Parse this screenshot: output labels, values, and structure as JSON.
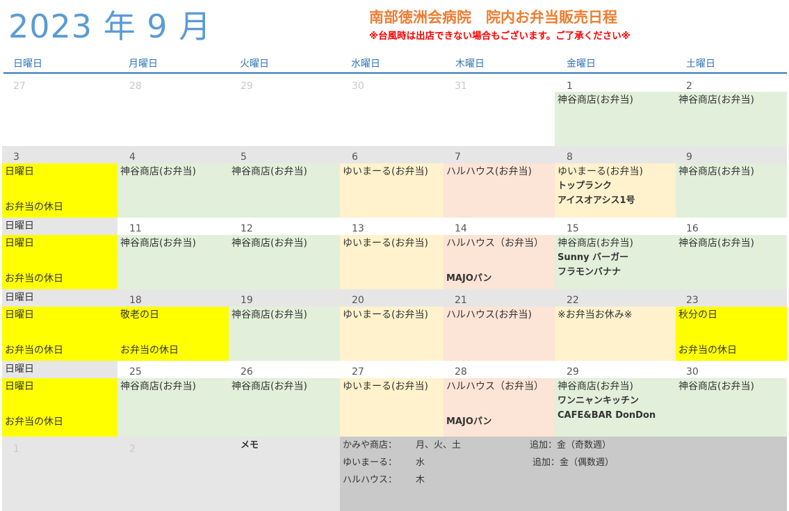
{
  "header": {
    "title": "2023 年 9 月",
    "hospital": "南部徳洲会病院　院内お弁当販売日程",
    "warning": "※台風時は出店できない場合もございます。ご了承ください※"
  },
  "weekdays": [
    "日曜日",
    "月曜日",
    "火曜日",
    "水曜日",
    "木曜日",
    "金曜日",
    "土曜日"
  ],
  "calendar": {
    "row1": {
      "dates": [
        "27",
        "28",
        "29",
        "30",
        "31",
        "1",
        "2"
      ],
      "fri": "神谷商店(お弁当)",
      "sat": "神谷商店(お弁当)"
    },
    "row2": {
      "dates": [
        "3",
        "4",
        "5",
        "6",
        "7",
        "8",
        "9"
      ],
      "sun_top": "日曜日",
      "sun_bottom": "お弁当の休日",
      "mon": "神谷商店(お弁当)",
      "tue": "神谷商店(お弁当)",
      "wed": "ゆいまーる(お弁当)",
      "thu": "ハルハウス(お弁当)",
      "fri": "ゆいまーる(お弁当)",
      "fri_extra1": "トップランク",
      "fri_extra2": "アイスオアシス1号",
      "sat": "神谷商店(お弁当)"
    },
    "row3": {
      "label": "日曜日",
      "dates": [
        "11",
        "12",
        "13",
        "14",
        "15",
        "16"
      ],
      "sun_top": "日曜日",
      "sun_bottom": "お弁当の休日",
      "mon": "神谷商店(お弁当)",
      "tue": "神谷商店(お弁当)",
      "wed": "ゆいまーる(お弁当)",
      "thu": "ハルハウス（お弁当）",
      "thu_extra": "MAJOパン",
      "fri": "神谷商店(お弁当)",
      "fri_extra1": "Sunny バーガー",
      "fri_extra2": "フラモンバナナ",
      "sat": "神谷商店(お弁当)"
    },
    "row4": {
      "label": "日曜日",
      "dates": [
        "18",
        "19",
        "20",
        "21",
        "22",
        "23"
      ],
      "sun_top": "日曜日",
      "sun_bottom": "お弁当の休日",
      "mon_top": "敬老の日",
      "mon_bottom": "お弁当の休日",
      "tue": "神谷商店(お弁当)",
      "wed": "ゆいまーる(お弁当)",
      "thu": "ハルハウス(お弁当)",
      "fri": "※お弁当お休み※",
      "sat_top": "秋分の日",
      "sat_bottom": "お弁当の休日"
    },
    "row5": {
      "label": "日曜日",
      "dates": [
        "25",
        "26",
        "27",
        "28",
        "29",
        "30"
      ],
      "sun_top": "日曜日",
      "sun_bottom": "お弁当の休日",
      "mon": "神谷商店(お弁当)",
      "tue": "神谷商店(お弁当)",
      "wed": "ゆいまーる(お弁当)",
      "thu": "ハルハウス（お弁当）",
      "thu_extra": "MAJOパン",
      "fri": "神谷商店(お弁当)",
      "fri_extra1": "ワンニャンキッチン",
      "fri_extra2": "CAFE&BAR DonDon",
      "sat": "神谷商店(お弁当)"
    },
    "row6": {
      "dates": [
        "1",
        "2"
      ],
      "memo_label": "メモ",
      "memo": [
        {
          "name": "かみや商店：",
          "days": "月、火、土",
          "extra": "追加：金（奇数週）"
        },
        {
          "name": "ゆいまーる：",
          "days": "水",
          "extra": "追加：金（偶数週）"
        },
        {
          "name": "ハルハウス：",
          "days": "木",
          "extra": ""
        }
      ]
    }
  },
  "colors": {
    "title": "#5b9bd5",
    "hospital": "#ed7d31",
    "warning": "#ff0000",
    "green": "#e2efda",
    "peach": "#fff2cc",
    "pink": "#fce4d6",
    "yellow": "#ffff00",
    "gray": "#e7e6e6"
  }
}
